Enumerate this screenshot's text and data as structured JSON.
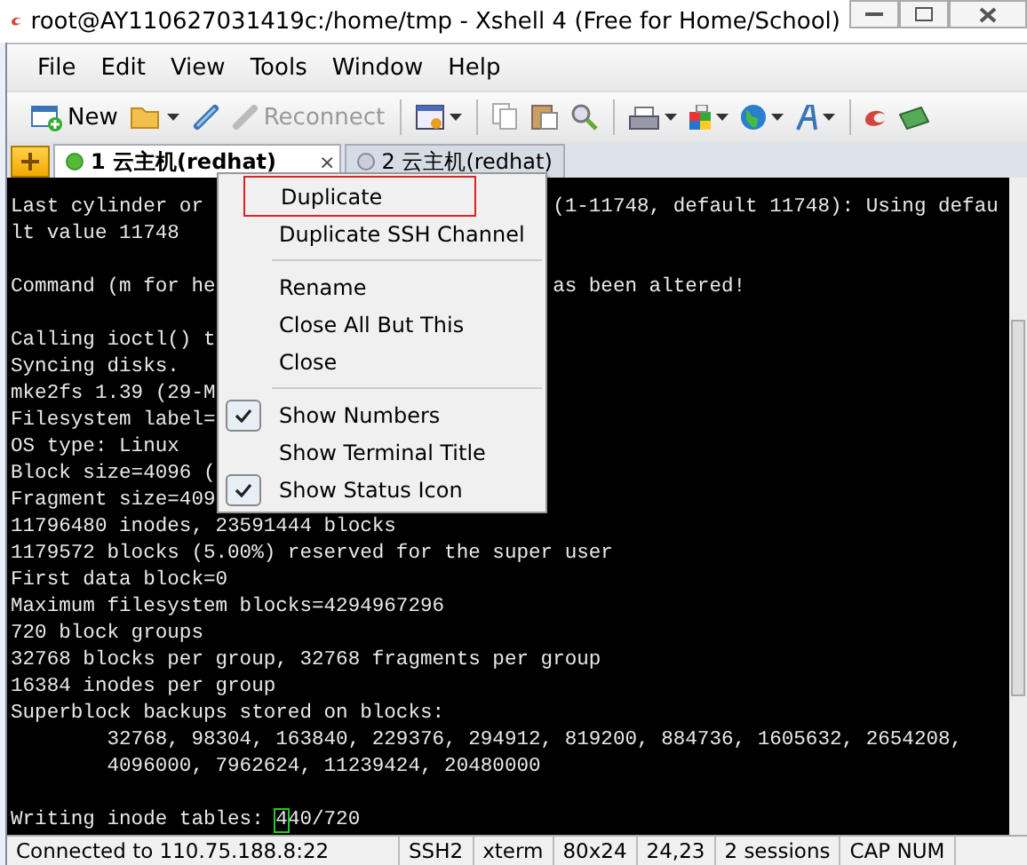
{
  "window": {
    "title": "root@AY110627031419c:/home/tmp - Xshell 4 (Free for Home/School)"
  },
  "menubar": [
    "File",
    "Edit",
    "View",
    "Tools",
    "Window",
    "Help"
  ],
  "toolbar": {
    "new": {
      "label": "New"
    },
    "reconnect": {
      "label": "Reconnect",
      "disabled": true
    }
  },
  "tabs": [
    {
      "label": "1 云主机(redhat)",
      "selected": true,
      "connected": true,
      "close": "×"
    },
    {
      "label": "2 云主机(redhat)",
      "selected": false,
      "connected": false
    }
  ],
  "terminal": {
    "lines": [
      {
        "text": "Last cylinder or",
        "right": "(1-11748, default 11748): Using defau"
      },
      {
        "text": "lt value 11748"
      },
      {
        "text": "Command (m for he",
        "right": "as been altered!",
        "blank_before": true
      },
      {
        "text": "Calling ioctl() t",
        "blank_before": true
      },
      {
        "text": "Syncing disks."
      },
      {
        "text": "mke2fs 1.39 (29-M"
      },
      {
        "text": "Filesystem label="
      },
      {
        "text": "OS type: Linux"
      },
      {
        "text": "Block size=4096 ("
      },
      {
        "text": "Fragment size=409"
      },
      {
        "text": "11796480 inodes, 23591444 blocks"
      },
      {
        "text": "1179572 blocks (5.00%) reserved for the super user"
      },
      {
        "text": "First data block=0"
      },
      {
        "text": "Maximum filesystem blocks=4294967296"
      },
      {
        "text": "720 block groups"
      },
      {
        "text": "32768 blocks per group, 32768 fragments per group"
      },
      {
        "text": "16384 inodes per group"
      },
      {
        "text": "Superblock backups stored on blocks:"
      },
      {
        "text": "        32768, 98304, 163840, 229376, 294912, 819200, 884736, 1605632, 2654208,"
      },
      {
        "text": "        4096000, 7962624, 11239424, 20480000"
      }
    ],
    "prompt": "Writing inode tables: ",
    "cursor": "4",
    "after_cursor": "40/720"
  },
  "context_menu": [
    {
      "kind": "item",
      "label": "Duplicate",
      "highlighted": true,
      "checked": false
    },
    {
      "kind": "item",
      "label": "Duplicate SSH Channel",
      "highlighted": false,
      "checked": false
    },
    {
      "kind": "separator"
    },
    {
      "kind": "item",
      "label": "Rename",
      "highlighted": false,
      "checked": false
    },
    {
      "kind": "item",
      "label": "Close All But This",
      "highlighted": false,
      "checked": false
    },
    {
      "kind": "item",
      "label": "Close",
      "highlighted": false,
      "checked": false
    },
    {
      "kind": "separator"
    },
    {
      "kind": "item",
      "label": "Show Numbers",
      "highlighted": false,
      "checked": true
    },
    {
      "kind": "item",
      "label": "Show Terminal Title",
      "highlighted": false,
      "checked": false
    },
    {
      "kind": "item",
      "label": "Show Status Icon",
      "highlighted": false,
      "checked": true
    }
  ],
  "status_bar": [
    "Connected to 110.75.188.8:22",
    "SSH2",
    "xterm",
    "80x24",
    "24,23",
    "2 sessions",
    "CAP NUM"
  ]
}
